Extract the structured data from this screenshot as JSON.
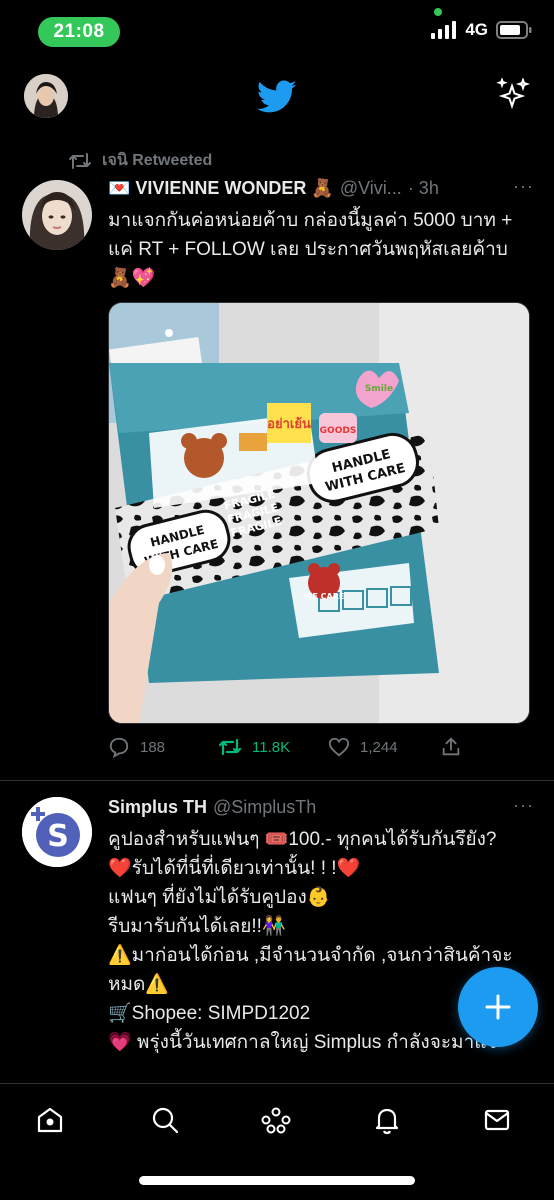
{
  "status_bar": {
    "time": "21:08",
    "network": "4G"
  },
  "header": {
    "logo_icon": "twitter-bird-icon",
    "right_icon": "sparkle-icon",
    "accent_color": "#1d9bf0"
  },
  "tweets": [
    {
      "retweeted_by": "เจนิ Retweeted",
      "name": "💌 VIVIENNE WONDER 🧸",
      "handle": "@Vivi...",
      "time": "· 3h",
      "more": "···",
      "text": "มาแจกกันค่อหน่อยค้าบ กล่องนี้มูลค่า 5000 บาท + แค่ RT + FOLLOW เลย ประกาศวันพฤหัสเลยค้าบ 🧸💖",
      "media": {
        "sticker_handle": "HANDLE WITH CARE",
        "sticker_fragile": "FRAGILE",
        "sticker_we_care": "WE CARE",
        "sticker_yay": "อย่าเย้น",
        "sticker_goods": "GOODS",
        "sticker_smile": "Smile"
      },
      "actions": {
        "replies": "188",
        "retweets": "11.8K",
        "likes": "1,244"
      }
    },
    {
      "name": "Simplus TH",
      "handle": "@SimplusTh",
      "more": "···",
      "lines": [
        "คูปองสำหรับแฟนๆ  🎟️100.- ทุกคนได้รับกันรึยัง?",
        "❤️รับได้ที่นี่ที่เดียวเท่านั้น! ! !❤️",
        "แฟนๆ ที่ยังไม่ได้รับคูปอง👶",
        "รีบมารับกันได้เลย!!👫",
        "⚠️มาก่อนได้ก่อน ,มีจำนวนจำกัด ,จนกว่าสินค้าจะหมด⚠️",
        "🛒Shopee: SIMPD1202",
        "💗 พรุ่งนี้วันเทศกาลใหญ่ Simplus กำลังจะมาแจ"
      ]
    }
  ],
  "tabbar": {
    "items": [
      "home-icon",
      "search-icon",
      "spaces-icon",
      "notifications-icon",
      "messages-icon"
    ]
  }
}
